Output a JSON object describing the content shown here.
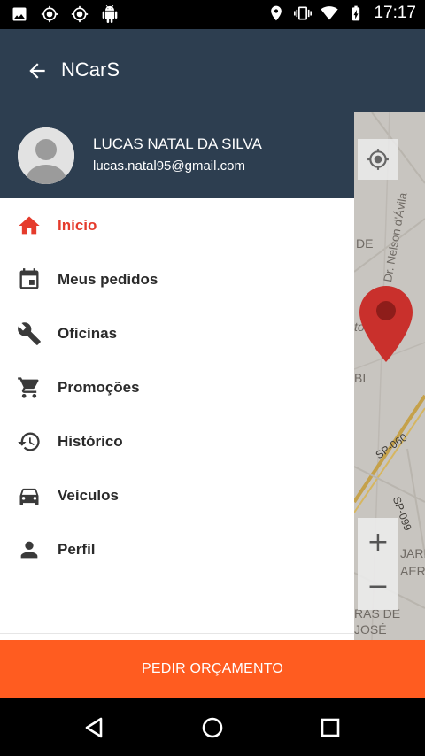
{
  "status_bar": {
    "time": "17:17",
    "left_icons": [
      "image-icon",
      "gps-icon",
      "gps-icon",
      "android-icon"
    ],
    "right_icons": [
      "location-icon",
      "vibrate-icon",
      "wifi-icon",
      "battery-charging-icon"
    ]
  },
  "app_bar": {
    "title": "NCarS",
    "back_icon": "arrow-back-icon",
    "background": "#2d3e50"
  },
  "drawer": {
    "user": {
      "name": "LUCAS NATAL DA SILVA",
      "email": "lucas.natal95@gmail.com"
    },
    "menu": [
      {
        "label": "Início",
        "icon": "home-icon",
        "active": true
      },
      {
        "label": "Meus pedidos",
        "icon": "calendar-icon",
        "active": false
      },
      {
        "label": "Oficinas",
        "icon": "wrench-icon",
        "active": false
      },
      {
        "label": "Promoções",
        "icon": "cart-icon",
        "active": false
      },
      {
        "label": "Histórico",
        "icon": "history-icon",
        "active": false
      },
      {
        "label": "Veículos",
        "icon": "car-icon",
        "active": false
      },
      {
        "label": "Perfil",
        "icon": "person-icon",
        "active": false
      }
    ],
    "active_color": "#e53b2c"
  },
  "map": {
    "labels": [
      "DE",
      "Dr. Nelson d'Ávila",
      "to",
      "BI",
      "SP-060",
      "SP-099",
      "JARD",
      "AEROP",
      "RAS DE",
      "JOSÉ"
    ],
    "zoom_in": "+",
    "zoom_out": "−"
  },
  "cta": {
    "label": "PEDIR ORÇAMENTO",
    "color": "#ff5c20"
  },
  "nav_bar": {
    "buttons": [
      "back-nav-icon",
      "home-nav-icon",
      "recents-nav-icon"
    ]
  }
}
